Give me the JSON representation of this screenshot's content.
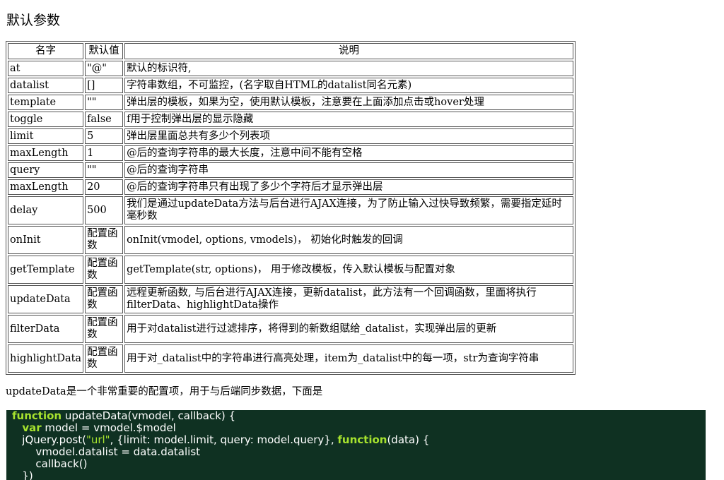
{
  "title": "默认参数",
  "table": {
    "headers": [
      "名字",
      "默认值",
      "说明"
    ],
    "rows": [
      {
        "name": "at",
        "default": "\"@\"",
        "desc": "默认的标识符,"
      },
      {
        "name": "datalist",
        "default": "[]",
        "desc": "字符串数组，不可监控，(名字取自HTML的datalist同名元素)"
      },
      {
        "name": "template",
        "default": "\"\"",
        "desc": "弹出层的模板，如果为空，使用默认模板，注意要在上面添加点击或hover处理"
      },
      {
        "name": "toggle",
        "default": "false",
        "desc": "f用于控制弹出层的显示隐藏"
      },
      {
        "name": "limit",
        "default": "5",
        "desc": "弹出层里面总共有多少个列表项"
      },
      {
        "name": "maxLength",
        "default": "1",
        "desc": "@后的查询字符串的最大长度，注意中间不能有空格"
      },
      {
        "name": "query",
        "default": "\"\"",
        "desc": "@后的查询字符串"
      },
      {
        "name": "maxLength",
        "default": "20",
        "desc": "@后的查询字符串只有出现了多少个字符后才显示弹出层"
      },
      {
        "name": "delay",
        "default": "500",
        "desc": "我们是通过updateData方法与后台进行AJAX连接，为了防止输入过快导致频繁，需要指定延时毫秒数"
      },
      {
        "name": "onInit",
        "default": "配置函数",
        "desc": "onInit(vmodel, options, vmodels)， 初始化时触发的回调"
      },
      {
        "name": "getTemplate",
        "default": "配置函数",
        "desc": "getTemplate(str, options)， 用于修改模板，传入默认模板与配置对象"
      },
      {
        "name": "updateData",
        "default": "配置函数",
        "desc": "远程更新函数, 与后台进行AJAX连接，更新datalist，此方法有一个回调函数，里面将执行filterData、highlightData操作"
      },
      {
        "name": "filterData",
        "default": "配置函数",
        "desc": "用于对datalist进行过滤排序，将得到的新数组赋给_datalist，实现弹出层的更新"
      },
      {
        "name": "highlightData",
        "default": "配置函数",
        "desc": "用于对_datalist中的字符串进行高亮处理，item为_datalist中的每一项，str为查询字符串"
      }
    ]
  },
  "intro": "updateData是一个非常重要的配置项，用于与后端同步数据，下面是",
  "code": {
    "line1": {
      "kw": "function",
      "rest": " updateData(vmodel, callback) {"
    },
    "line2": {
      "indent": "   ",
      "kw": "var",
      "rest": " model = vmodel.$model"
    },
    "line3": {
      "pre": "   jQuery.post(",
      "str": "\"url\"",
      "mid": ", {limit: model.limit, query: model.query}, ",
      "kw": "function",
      "rest": "(data) {"
    },
    "line4": "       vmodel.datalist = data.datalist",
    "line5": "       callback()",
    "line6": "   })"
  }
}
